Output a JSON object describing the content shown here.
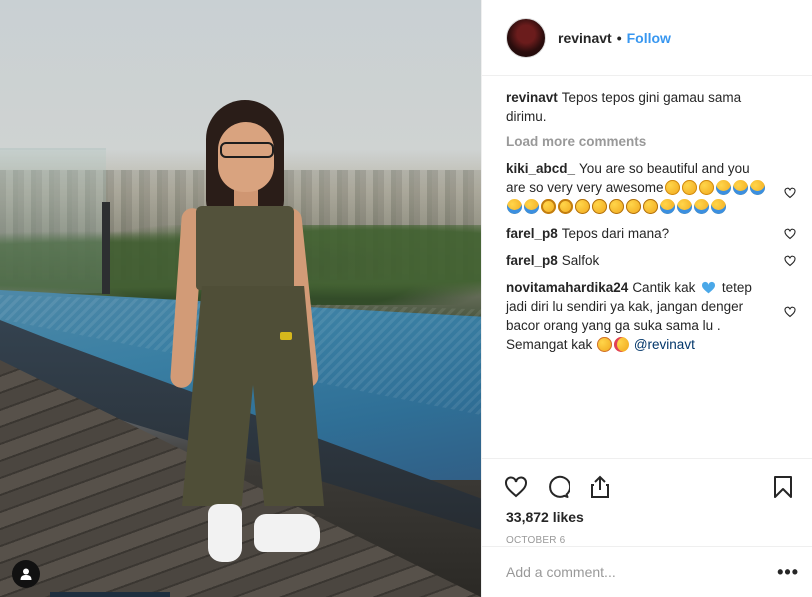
{
  "post": {
    "username": "revinavt",
    "separator": "•",
    "follow_label": "Follow",
    "caption": "Tepos tepos gini gamau sama dirimu.",
    "load_more": "Load more comments",
    "comments": [
      {
        "user": "kiki_abcd_",
        "text": "You are so beautiful and you are so very very awesome",
        "emojis": [
          "heart-eyes",
          "heart-eyes",
          "heart-eyes",
          "cry",
          "cry",
          "cry",
          "cry",
          "cry",
          "shock",
          "shock",
          "frown",
          "frown",
          "frown",
          "frown",
          "frown",
          "cry",
          "cry",
          "cry",
          "cry"
        ]
      },
      {
        "user": "farel_p8",
        "text": "Tepos dari mana?"
      },
      {
        "user": "farel_p8",
        "text": "Salfok"
      },
      {
        "user": "novitamahardika24",
        "text_a": "Cantik kak",
        "text_b": "tetep jadi diri lu sendiri ya kak, jangan denger bacor orang yang ga suka sama lu . Semangat kak",
        "mention": "@revinavt"
      }
    ],
    "likes": "33,872 likes",
    "date": "OCTOBER 6",
    "comment_placeholder": "Add a comment...",
    "more_label": "•••"
  },
  "colors": {
    "link_blue": "#3897f0",
    "mention_blue": "#003569",
    "muted_gray": "#999999",
    "border": "#efefef"
  },
  "icons": {
    "like": "heart-outline-icon",
    "comment": "speech-bubble-icon",
    "share": "share-upload-icon",
    "save": "bookmark-icon",
    "tag": "user-silhouette-icon"
  }
}
